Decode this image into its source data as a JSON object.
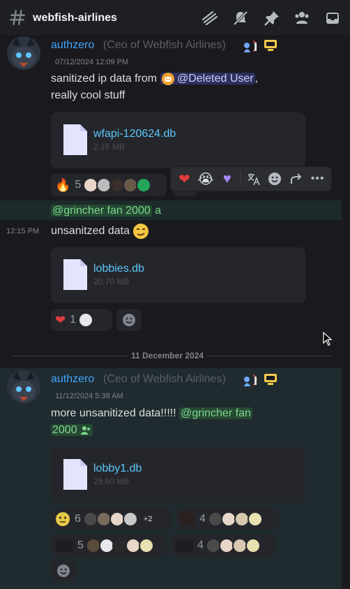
{
  "header": {
    "channel": "webfish-airlines",
    "icons": [
      "threads-icon",
      "mute-icon",
      "pin-icon",
      "members-icon",
      "inbox-icon"
    ]
  },
  "messages": [
    {
      "author": "authzero",
      "role": "(Ceo of Webfish Airlines)",
      "timestamp": "07/12/2024 12:09 PM",
      "text_1": "sanitized ip data from",
      "mention": "@Deleted User",
      "text_2": ",",
      "text_3": "really cool stuff",
      "file": {
        "name": "wfapi-120624.db",
        "size": "2.16 MB"
      },
      "reactions": [
        {
          "emoji": "fire",
          "count": "5"
        }
      ]
    },
    {
      "reply_mention": "@grincher fan 2000",
      "reply_suffix": "a",
      "timestamp": "12:15 PM",
      "text": "unsanitzed data",
      "file": {
        "name": "lobbies.db",
        "size": "20.70 MB"
      },
      "reactions": [
        {
          "emoji": "heart",
          "count": "1"
        }
      ]
    },
    {
      "author": "authzero",
      "role": "(Ceo of Webfish Airlines)",
      "timestamp": "11/12/2024 5:38 AM",
      "text": "more unsanitized data!!!!!",
      "mention_1": "@grincher fan",
      "mention_2": "2000",
      "file": {
        "name": "lobby1.db",
        "size": "29.60 MB"
      },
      "reactions": [
        {
          "emoji": "hmm",
          "count": "6",
          "extra": "+2"
        },
        {
          "emoji": "photo",
          "count": "4"
        },
        {
          "emoji": "sticker",
          "count": "5"
        },
        {
          "emoji": "dark",
          "count": "4"
        }
      ]
    }
  ],
  "date_divider": "11 December 2024",
  "hover_bar": [
    "heart",
    "crying",
    "purple-heart",
    "translate",
    "add-reaction",
    "forward",
    "more"
  ],
  "colors": {
    "accent": "#3ea6ff",
    "mention_bg": "#3c4270",
    "green": "#7ed68b"
  }
}
